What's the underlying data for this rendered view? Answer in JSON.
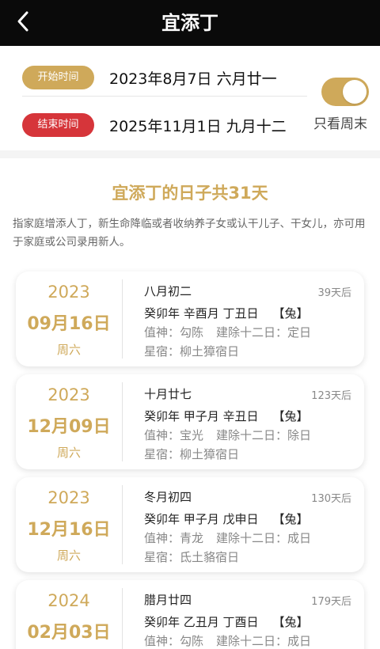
{
  "header": {
    "title": "宜添丁",
    "back_icon": "chevron-left-icon"
  },
  "range": {
    "start_label": "开始时间",
    "start_value": "2023年8月7日 六月廿一",
    "end_label": "结束时间",
    "end_value": "2025年11月1日 九月十二",
    "weekend_toggle_label": "只看周末",
    "weekend_only": true,
    "colors": {
      "gold": "#cfa95a",
      "red": "#d6353a"
    }
  },
  "summary": {
    "title": "宜添丁的日子共31天",
    "description": "指家庭增添人丁，新生命降临或者收纳养子女或认干儿子、干女儿，亦可用于家庭或公司录用新人。"
  },
  "days": [
    {
      "year": "2023",
      "date": "09月16日",
      "weekday": "周六",
      "lunar": "八月初二",
      "days_after": "39天后",
      "ganzhi": "癸卯年 辛酉月 丁丑日",
      "zodiac": "【兔】",
      "deity": "值神：勾陈",
      "jianchu": "建除十二日：定日",
      "star": "星宿：柳土獐宿日"
    },
    {
      "year": "2023",
      "date": "12月09日",
      "weekday": "周六",
      "lunar": "十月廿七",
      "days_after": "123天后",
      "ganzhi": "癸卯年 甲子月 辛丑日",
      "zodiac": "【兔】",
      "deity": "值神：宝光",
      "jianchu": "建除十二日：除日",
      "star": "星宿：柳土獐宿日"
    },
    {
      "year": "2023",
      "date": "12月16日",
      "weekday": "周六",
      "lunar": "冬月初四",
      "days_after": "130天后",
      "ganzhi": "癸卯年 甲子月 戊申日",
      "zodiac": "【兔】",
      "deity": "值神：青龙",
      "jianchu": "建除十二日：成日",
      "star": "星宿：氐土貉宿日"
    },
    {
      "year": "2024",
      "date": "02月03日",
      "weekday": "",
      "lunar": "腊月廿四",
      "days_after": "179天后",
      "ganzhi": "癸卯年 乙丑月 丁酉日",
      "zodiac": "【兔】",
      "deity": "值神：勾陈",
      "jianchu": "建除十二日：成日",
      "star": ""
    }
  ]
}
